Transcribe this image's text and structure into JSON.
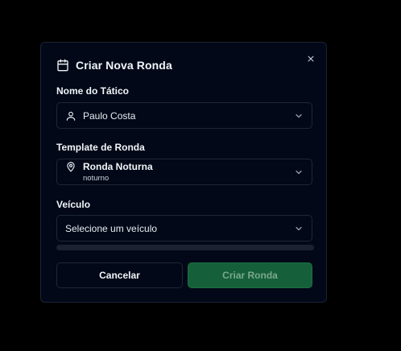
{
  "modal": {
    "title": "Criar Nova Ronda",
    "title_icon": "calendar-icon",
    "close_icon": "close-icon"
  },
  "fields": {
    "tactical": {
      "label": "Nome do Tático",
      "value": "Paulo Costa",
      "icon": "user-icon"
    },
    "template": {
      "label": "Template de Ronda",
      "value": "Ronda Noturna",
      "subvalue": "noturno",
      "icon": "map-pin-icon"
    },
    "vehicle": {
      "label": "Veículo",
      "placeholder": "Selecione um veículo"
    }
  },
  "actions": {
    "cancel_label": "Cancelar",
    "create_label": "Criar Ronda"
  },
  "colors": {
    "background": "#000000",
    "modal_bg": "#020817",
    "border": "#1e2636",
    "primary_button": "#15603a",
    "primary_text_disabled": "#7aa88d"
  }
}
